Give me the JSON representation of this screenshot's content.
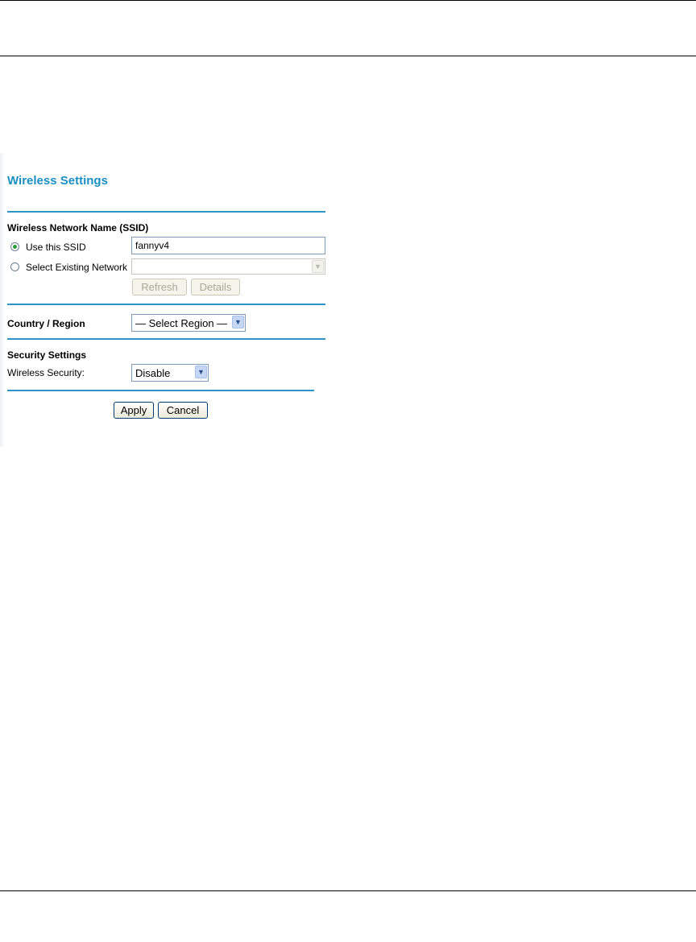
{
  "page": {
    "title": "Wireless Settings",
    "ssid_section": {
      "heading": "Wireless Network Name (SSID)",
      "use_ssid_label": "Use this SSID",
      "ssid_value": "fannyv4",
      "select_existing_label": "Select Existing Network",
      "existing_network_value": "",
      "refresh_label": "Refresh",
      "details_label": "Details"
    },
    "region": {
      "label": "Country / Region",
      "selected": "— Select Region —"
    },
    "security": {
      "heading": "Security Settings",
      "wireless_security_label": "Wireless Security:",
      "selected": "Disable"
    },
    "buttons": {
      "apply": "Apply",
      "cancel": "Cancel"
    },
    "icons": {
      "dropdown": "chevron-down-icon"
    },
    "colors": {
      "title": "#1a8fc2",
      "separator": "#2d95c8"
    }
  }
}
